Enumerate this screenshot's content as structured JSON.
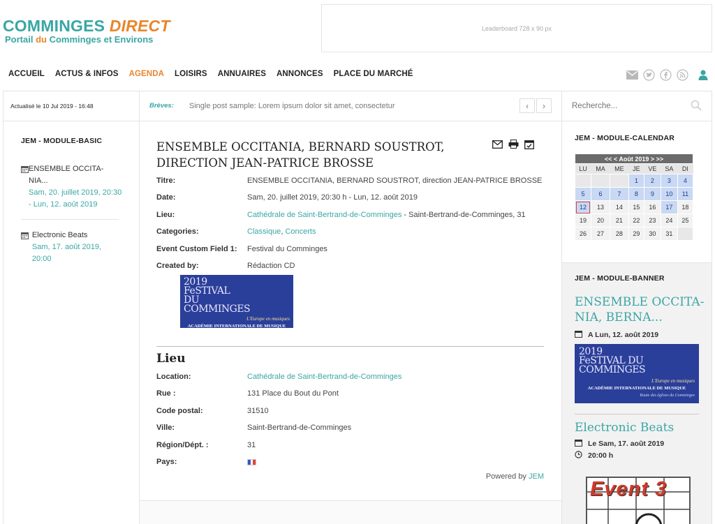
{
  "site": {
    "logo_part1": "COMMINGES ",
    "logo_part2": "DIRECT",
    "tagline_a": "Portail ",
    "tagline_b": "du",
    "tagline_c": " Comminges et Environs",
    "leaderboard": "Leaderboard  728 x 90 px"
  },
  "nav": {
    "items": [
      "ACCUEIL",
      "ACTUS & INFOS",
      "AGENDA",
      "LOISIRS",
      "ANNUAIRES",
      "ANNONCES",
      "PLACE DU MARCHÉ"
    ],
    "active": "AGENDA",
    "icons": [
      "envelope-icon",
      "twitter-icon",
      "facebook-icon",
      "rss-icon",
      "user-icon"
    ]
  },
  "topbar": {
    "updated": "Actualisé le 10 Jul 2019 - 16:48",
    "breves_label": "Brèves:",
    "breves_text": "Single post sample: Lorem ipsum dolor sit amet, consectetur",
    "search_placeholder": "Recherche..."
  },
  "left": {
    "module_title": "JEM - MODULE-BASIC",
    "events": [
      {
        "name": "ENSEMBLE OCCITA-NIA...",
        "date": "Sam, 20. juillet 2019, 20:30 - Lun, 12. août 2019"
      },
      {
        "name": "Electronic Beats",
        "date": "Sam, 17. août 2019, 20:00"
      }
    ]
  },
  "event": {
    "title": "ENSEMBLE OCCITANIA, BERNARD SOUSTROT, DIRECTION JEAN-PATRICE BROSSE",
    "rows": {
      "titre_label": "Titre:",
      "titre_value": "ENSEMBLE OCCITANIA, BERNARD SOUSTROT, direction JEAN-PATRICE BROSSE",
      "date_label": "Date:",
      "date_value": "Sam, 20. juillet 2019, 20:30 h - Lun, 12. août 2019",
      "lieu_label": "Lieu:",
      "lieu_link": "Cathédrale de Saint-Bertrand-de-Comminges",
      "lieu_rest": " - Saint-Bertrand-de-Comminges, 31",
      "cat_label": "Categories:",
      "cat_1": "Classique",
      "cat_sep": ", ",
      "cat_2": "Concerts",
      "custom_label": "Event Custom Field 1:",
      "custom_value": "Festival du Comminges",
      "created_label": "Created by:",
      "created_value": "Rédaction CD"
    },
    "banner": {
      "line1": "2019 FeSTIVAL DU COMMINGES",
      "line2": "L'Europe en musiques",
      "line3": "ACADÉMIE INTERNATIONALE DE MUSIQUE",
      "line4": "Route des églises du Comminges"
    }
  },
  "venue": {
    "section_title": "Lieu",
    "location_label": "Location:",
    "location_value": "Cathédrale de Saint-Bertrand-de-Comminges",
    "rue_label": "Rue :",
    "rue_value": "131 Place du Bout du Pont",
    "cp_label": "Code postal:",
    "cp_value": "31510",
    "ville_label": "Ville:",
    "ville_value": "Saint-Bertrand-de-Comminges",
    "region_label": "Région/Dépt. :",
    "region_value": "31",
    "pays_label": "Pays:",
    "pays_flag": "france-flag-icon"
  },
  "powered": {
    "prefix": "Powered by ",
    "link": "JEM"
  },
  "right": {
    "calendar_title": "JEM - MODULE-CALENDAR",
    "calendar_nav": "<< < Août 2019 > >>",
    "weekdays": [
      "LU",
      "MA",
      "ME",
      "JE",
      "VE",
      "SA",
      "DI"
    ],
    "weeks": [
      [
        "",
        "",
        "",
        "1",
        "2",
        "3",
        "4"
      ],
      [
        "5",
        "6",
        "7",
        "8",
        "9",
        "10",
        "11"
      ],
      [
        "12",
        "13",
        "14",
        "15",
        "16",
        "17",
        "18"
      ],
      [
        "19",
        "20",
        "21",
        "22",
        "23",
        "24",
        "25"
      ],
      [
        "26",
        "27",
        "28",
        "29",
        "30",
        "31",
        ""
      ]
    ],
    "event_days": [
      "1",
      "2",
      "3",
      "4",
      "5",
      "6",
      "7",
      "8",
      "9",
      "10",
      "11",
      "12",
      "17"
    ],
    "today": "12",
    "banner_title": "JEM - MODULE-BANNER",
    "banner_ev1_title": "ENSEMBLE OCCITA-NIA, BERNA...",
    "banner_ev1_date": "A Lun, 12. août 2019",
    "banner_ev2_title": "Electronic Beats",
    "banner_ev2_date": "Le Sam, 17. août 2019",
    "banner_ev2_time": "20:00 h",
    "event3_text": "Event 3"
  },
  "colors": {
    "accent": "#3aa6a4",
    "orange": "#e8862d",
    "banner_blue": "#2a3f99"
  }
}
